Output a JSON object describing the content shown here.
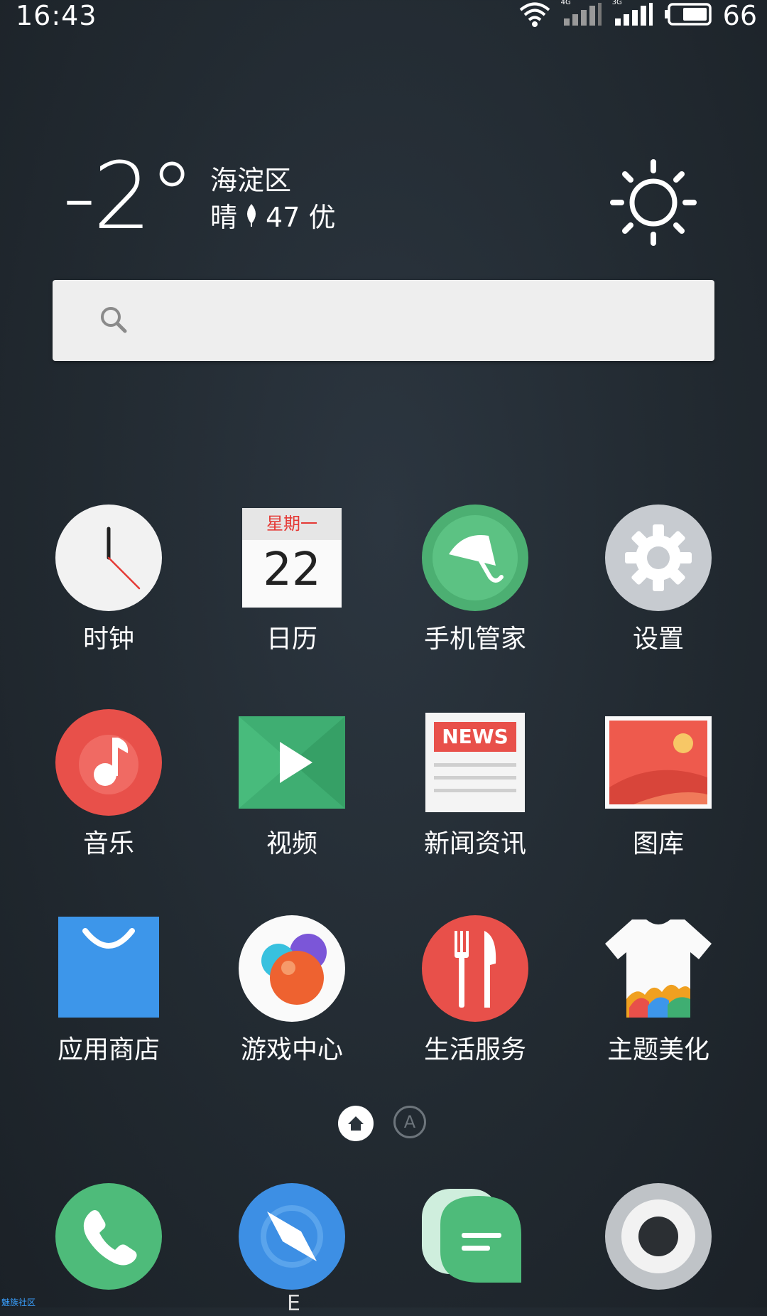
{
  "status_bar": {
    "time": "16:43",
    "battery_level": "66",
    "net_1": "4G",
    "net_2": "3G"
  },
  "weather": {
    "temperature": "-2°",
    "district": "海淀区",
    "condition": "晴",
    "aqi": "47 优",
    "icon": "sun-icon"
  },
  "search": {
    "icon": "search-icon"
  },
  "calendar_icon": {
    "weekday": "星期一",
    "day": "22"
  },
  "news_icon": {
    "banner": "NEWS"
  },
  "apps": [
    {
      "label": "时钟",
      "icon": "clock-icon"
    },
    {
      "label": "日历",
      "icon": "calendar-icon"
    },
    {
      "label": "手机管家",
      "icon": "umbrella-icon"
    },
    {
      "label": "设置",
      "icon": "gear-icon"
    },
    {
      "label": "音乐",
      "icon": "music-note-icon"
    },
    {
      "label": "视频",
      "icon": "play-icon"
    },
    {
      "label": "新闻资讯",
      "icon": "newspaper-icon"
    },
    {
      "label": "图库",
      "icon": "picture-icon"
    },
    {
      "label": "应用商店",
      "icon": "shopping-bag-icon"
    },
    {
      "label": "游戏中心",
      "icon": "game-balls-icon"
    },
    {
      "label": "生活服务",
      "icon": "fork-knife-icon"
    },
    {
      "label": "主题美化",
      "icon": "tshirt-icon"
    }
  ],
  "page_indicator": {
    "home_icon": "home-icon",
    "letter": "A"
  },
  "dock": [
    {
      "icon": "phone-icon"
    },
    {
      "icon": "compass-icon"
    },
    {
      "icon": "message-icon"
    },
    {
      "icon": "camera-icon"
    }
  ],
  "dock_partial_label": "E",
  "watermark": "魅族社区"
}
